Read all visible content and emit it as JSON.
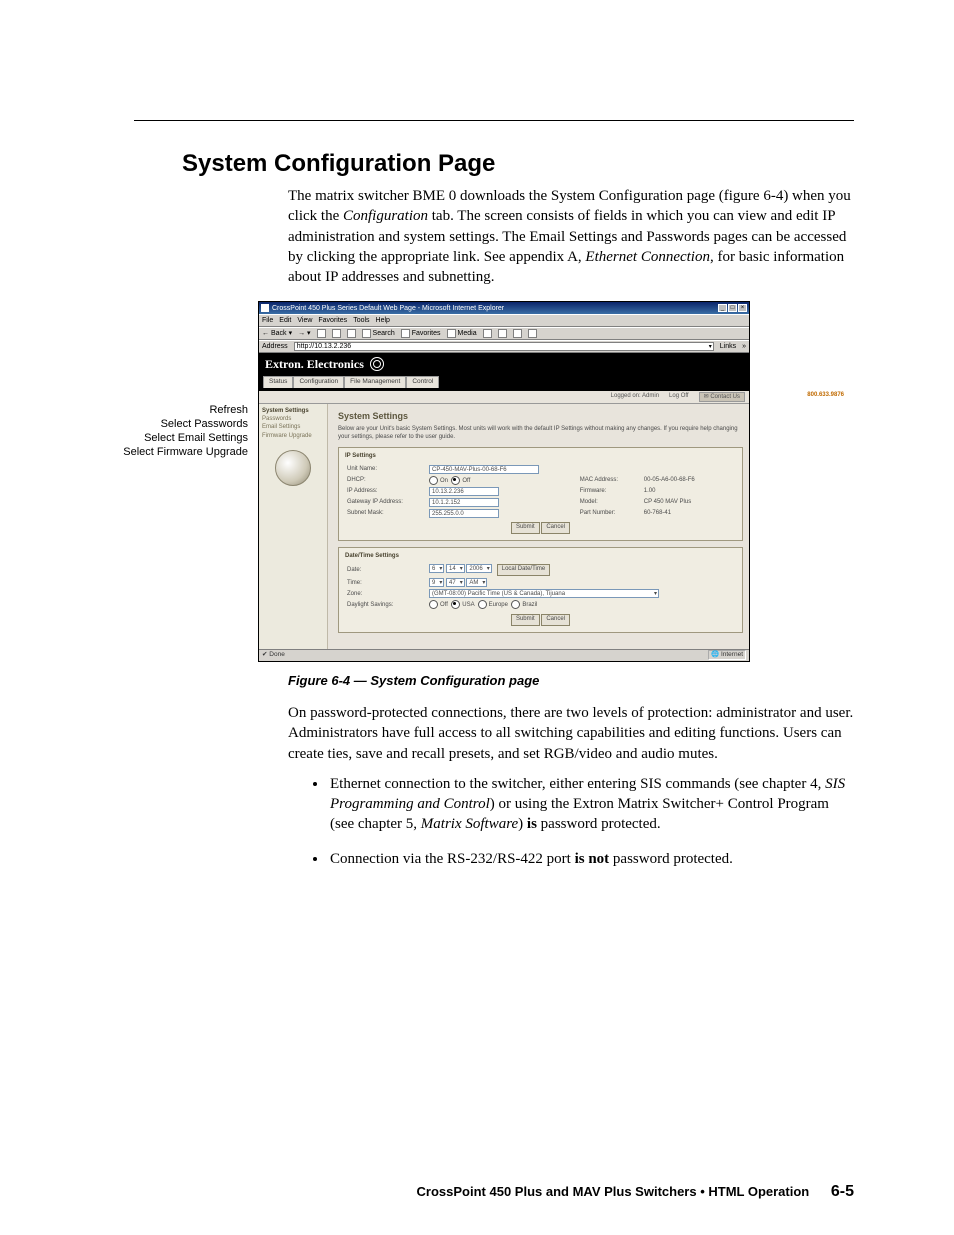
{
  "section_title": "System Configuration Page",
  "intro": {
    "pre": "The matrix switcher BME 0 downloads the System Configuration page (figure 6-4) when you click the ",
    "em1": "Configuration",
    "mid": " tab.  The screen consists of fields in which you can view and edit IP administration and system settings.  The Email Settings and Passwords pages can be accessed by clicking the appropriate link.  See appendix A, ",
    "em2": "Ethernet Connection",
    "post": ", for basic information about IP addresses and subnetting."
  },
  "callouts": [
    "Refresh",
    "Select Passwords",
    "Select Email Settings",
    "Select Firmware Upgrade"
  ],
  "figure_caption": "Figure 6-4 — System Configuration page",
  "after_fig_p": "On password-protected connections, there are two levels of protection: administrator and user.  Administrators have full access to all switching capabilities and editing functions.  Users can create ties, save and recall presets, and set RGB/video and audio mutes.",
  "bullets": [
    {
      "pre": "Ethernet connection to the switcher, either entering SIS commands (see chapter 4, ",
      "em1": "SIS Programming and Control",
      "mid": ") or using the Extron Matrix Switcher+ Control Program (see chapter 5, ",
      "em2": "Matrix Software",
      "post1": ") ",
      "strong": "is",
      "post2": " password protected."
    },
    {
      "pre": "Connection via the RS-232/RS-422 port ",
      "strong": "is not",
      "post": " password protected."
    }
  ],
  "footer": {
    "title": "CrossPoint 450 Plus and MAV Plus Switchers • HTML Operation",
    "page": "6-5"
  },
  "shot": {
    "titlebar": "CrossPoint 450 Plus Series Default Web Page - Microsoft Internet Explorer",
    "win_min": "_",
    "win_max": "□",
    "win_close": "×",
    "menus": [
      "File",
      "Edit",
      "View",
      "Favorites",
      "Tools",
      "Help"
    ],
    "toolbar": {
      "back": "Back",
      "search": "Search",
      "favorites": "Favorites",
      "media": "Media"
    },
    "addr_label": "Address",
    "addr_value": "http://10.13.2.236",
    "links_label": "Links",
    "brand": "Extron. Electronics",
    "tabs": [
      "Status",
      "Configuration",
      "File Management",
      "Control"
    ],
    "phone": "800.633.9876",
    "logged": "Logged on: Admin",
    "logoff": "Log Off",
    "contact": "Contact Us",
    "sidebar": {
      "header": "System Settings",
      "items": [
        "Passwords",
        "Email Settings",
        "Firmware Upgrade"
      ]
    },
    "main": {
      "heading": "System Settings",
      "lead": "Below are your Unit's basic System Settings. Most units will work with the default IP Settings without making any changes. If you require help changing your settings, please refer to the user guide.",
      "ip": {
        "title": "IP Settings",
        "unit_name_l": "Unit Name:",
        "unit_name_v": "CP-450-MAV-Plus-00-68-F6",
        "dhcp_l": "DHCP:",
        "dhcp_on": "On",
        "dhcp_off": "Off",
        "mac_l": "MAC Address:",
        "mac_v": "00-05-A6-00-68-F6",
        "ip_l": "IP Address:",
        "ip_v": "10.13.2.236",
        "fw_l": "Firmware:",
        "fw_v": "1.00",
        "gw_l": "Gateway IP Address:",
        "gw_v": "10.1.2.152",
        "model_l": "Model:",
        "model_v": "CP 450 MAV Plus",
        "sn_l": "Subnet Mask:",
        "sn_v": "255.255.0.0",
        "part_l": "Part Number:",
        "part_v": "60-768-41",
        "submit": "Submit",
        "cancel": "Cancel"
      },
      "dt": {
        "title": "Date/Time Settings",
        "date_l": "Date:",
        "month": "6",
        "day": "14",
        "year": "2006",
        "local_btn": "Local Date/Time",
        "time_l": "Time:",
        "hour": "9",
        "min": "47",
        "ampm": "AM",
        "zone_l": "Zone:",
        "zone_v": "(GMT-08:00) Pacific Time (US & Canada), Tijuana",
        "ds_l": "Daylight Savings:",
        "ds_off": "Off",
        "ds_usa": "USA",
        "ds_eu": "Europe",
        "ds_br": "Brazil",
        "submit": "Submit",
        "cancel": "Cancel"
      }
    },
    "status": {
      "done": "Done",
      "zone": "Internet"
    }
  }
}
